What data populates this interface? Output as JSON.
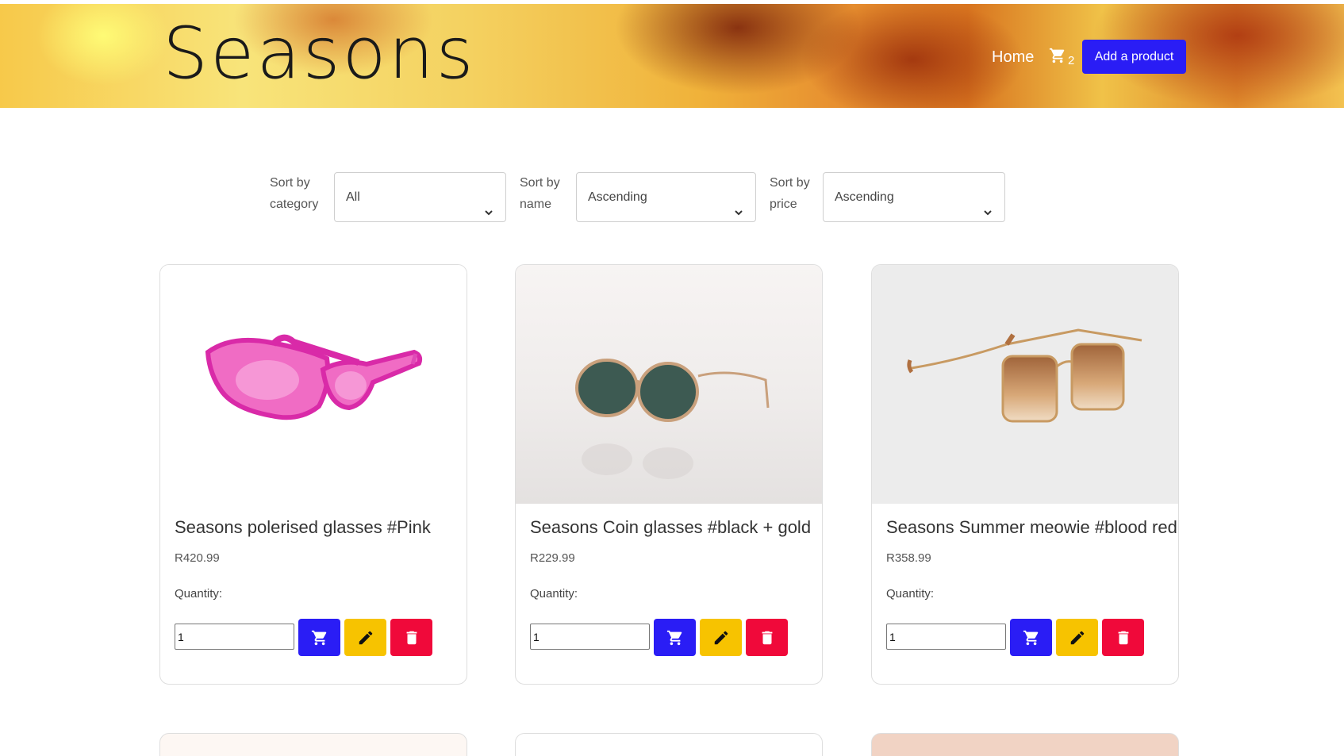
{
  "header": {
    "brand": "Seasons",
    "nav_home": "Home",
    "cart_count": "2",
    "add_product_label": "Add a product"
  },
  "filters": {
    "category": {
      "label_line1": "Sort by",
      "label_line2": "category",
      "value": "All"
    },
    "name": {
      "label_line1": "Sort by",
      "label_line2": "name",
      "value": "Ascending"
    },
    "price": {
      "label_line1": "Sort by",
      "label_line2": "price",
      "value": "Ascending"
    }
  },
  "products": [
    {
      "title": "Seasons polerised glasses #Pink",
      "price": "R420.99",
      "quantity_label": "Quantity:",
      "quantity_value": "1"
    },
    {
      "title": "Seasons Coin glasses #black + gold",
      "price": "R229.99",
      "quantity_label": "Quantity:",
      "quantity_value": "1"
    },
    {
      "title": "Seasons Summer meowie #blood red",
      "price": "R358.99",
      "quantity_label": "Quantity:",
      "quantity_value": "1"
    }
  ],
  "colors": {
    "primary": "#2a1df5",
    "edit": "#f7c300",
    "delete": "#f0093a"
  },
  "icons": [
    "cart-icon",
    "pencil-icon",
    "trash-icon",
    "chevron-down-icon"
  ]
}
